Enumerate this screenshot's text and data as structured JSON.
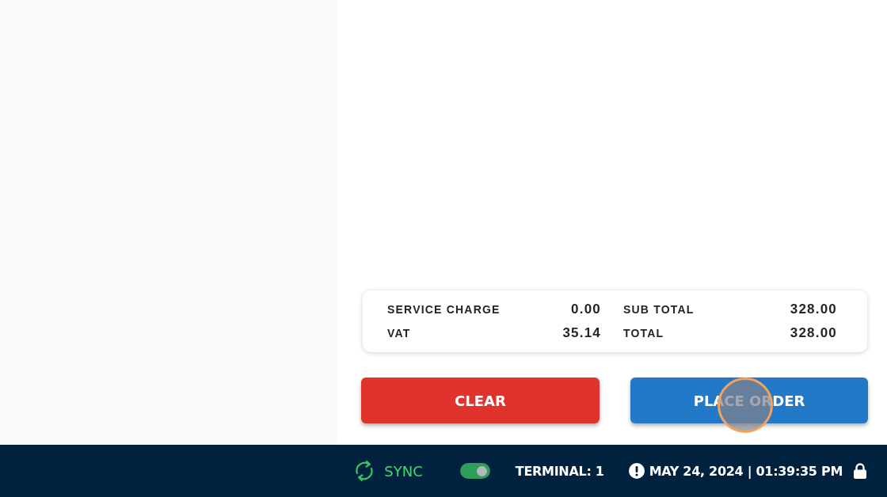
{
  "summary": [
    {
      "label": "SERVICE CHARGE",
      "value": "0.00"
    },
    {
      "label": "SUB TOTAL",
      "value": "328.00"
    },
    {
      "label": "VAT",
      "value": "35.14"
    },
    {
      "label": "TOTAL",
      "value": "328.00"
    }
  ],
  "actions": [
    {
      "kind": "clear",
      "label": "CLEAR"
    },
    {
      "kind": "place",
      "label": "PLACE ORDER"
    }
  ],
  "status_bar": {
    "sync": {
      "label": "SYNC"
    },
    "toggle": {
      "on": true
    },
    "terminal": "TERMINAL: 1",
    "datetime": "MAY 24, 2024 | 01:39:35 PM"
  }
}
